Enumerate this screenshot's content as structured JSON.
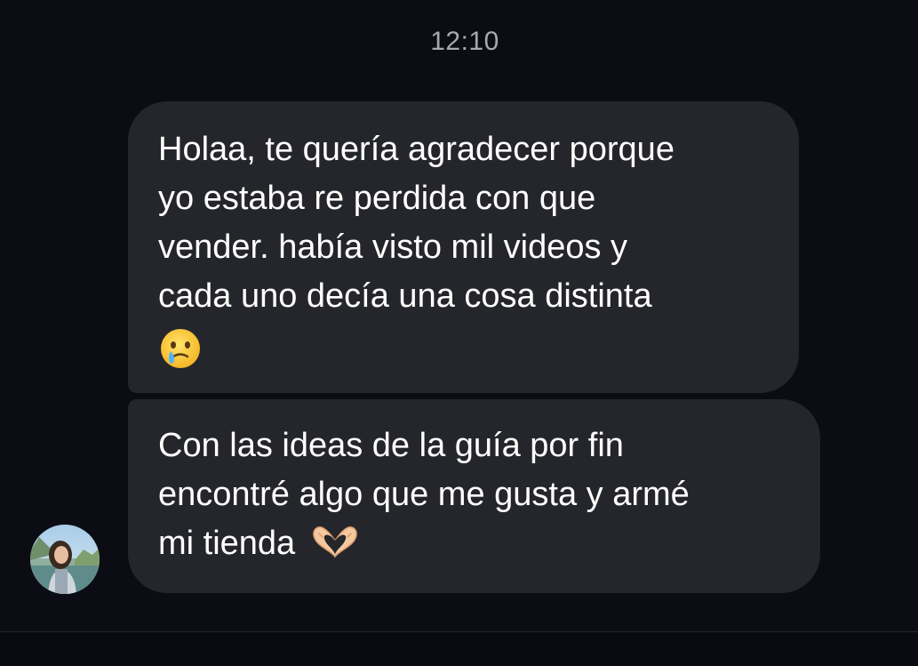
{
  "conversation": {
    "timestamp": "12:10",
    "messages": [
      {
        "text": "Holaa, te quería agradecer porque\nyo estaba re perdida con que\nvender. había visto mil videos y\ncada uno decía una cosa distinta",
        "emoji": "face-holding-back-tears-icon"
      },
      {
        "text": "Con las ideas de la guía por fin\nencontré algo que me gusta y armé\nmi tienda ",
        "emoji": "heart-hands-icon"
      }
    ]
  },
  "colors": {
    "background": "#0c0d14",
    "bubble": "#25262b",
    "timestamp": "#a8a9b0",
    "text": "#ffffff"
  }
}
